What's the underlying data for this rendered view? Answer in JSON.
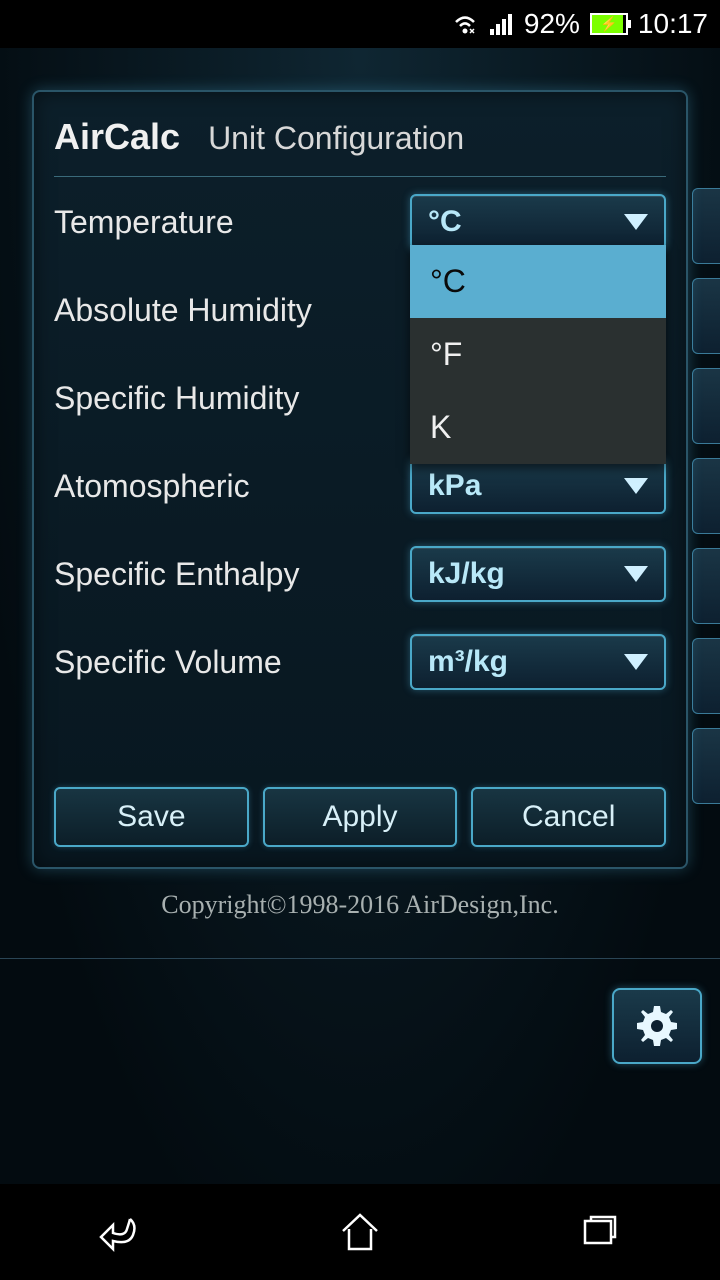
{
  "status": {
    "battery_percent": "92%",
    "time": "10:17"
  },
  "dialog": {
    "title": "AirCalc",
    "subtitle": "Unit Configuration",
    "rows": [
      {
        "label": "Temperature",
        "value": "°C"
      },
      {
        "label": "Absolute Humidity",
        "value": ""
      },
      {
        "label": "Specific Humidity",
        "value": ""
      },
      {
        "label": "Atomospheric",
        "value": "kPa"
      },
      {
        "label": "Specific Enthalpy",
        "value": "kJ/kg"
      },
      {
        "label": "Specific Volume",
        "value": "m³/kg"
      }
    ],
    "temperature_options": [
      "°C",
      "°F",
      "K"
    ],
    "buttons": {
      "save": "Save",
      "apply": "Apply",
      "cancel": "Cancel"
    }
  },
  "copyright": "Copyright©1998-2016 AirDesign,Inc."
}
